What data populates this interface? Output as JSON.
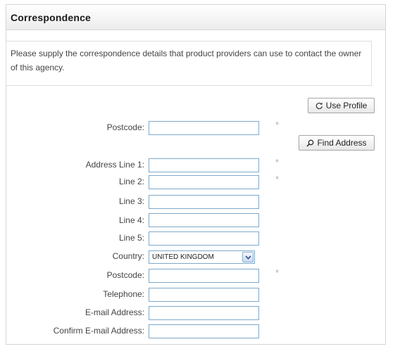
{
  "panel": {
    "title": "Correspondence",
    "intro": "Please supply the correspondence details that product providers can use to contact the owner of this agency."
  },
  "buttons": {
    "use_profile": {
      "label": "Use Profile",
      "icon": "refresh-icon"
    },
    "find_address": {
      "label": "Find Address",
      "icon": "search-icon"
    }
  },
  "form": {
    "required_marker": "*",
    "fields": {
      "postcode_lookup": {
        "label": "Postcode:",
        "value": "",
        "required": true
      },
      "address_line_1": {
        "label": "Address Line 1:",
        "value": "",
        "required": true
      },
      "line_2": {
        "label": "Line 2:",
        "value": "",
        "required": true
      },
      "line_3": {
        "label": "Line 3:",
        "value": ""
      },
      "line_4": {
        "label": "Line 4:",
        "value": ""
      },
      "line_5": {
        "label": "Line 5:",
        "value": ""
      },
      "country": {
        "label": "Country:",
        "selected": "UNITED KINGDOM"
      },
      "postcode": {
        "label": "Postcode:",
        "value": "",
        "required": true
      },
      "telephone": {
        "label": "Telephone:",
        "value": ""
      },
      "email": {
        "label": "E-mail Address:",
        "value": ""
      },
      "confirm_email": {
        "label": "Confirm E-mail Address:",
        "value": ""
      }
    }
  },
  "colors": {
    "field_border": "#7fa9c9",
    "required_star": "#b0b0b0",
    "label_text": "#444444"
  }
}
